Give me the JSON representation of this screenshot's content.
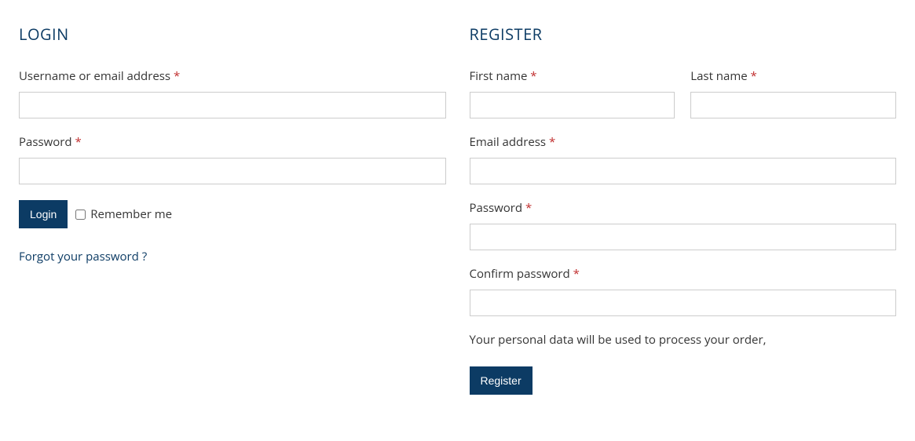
{
  "login": {
    "title": "LOGIN",
    "username_label": "Username or email address ",
    "password_label": "Password ",
    "button_label": "Login",
    "remember_label": "Remember me",
    "forgot_label": "Forgot your password ?"
  },
  "register": {
    "title": "REGISTER",
    "first_name_label": "First name ",
    "last_name_label": "Last name ",
    "email_label": "Email address ",
    "password_label": "Password ",
    "confirm_password_label": "Confirm password ",
    "privacy_text": "Your personal data will be used to process your order,",
    "button_label": "Register"
  },
  "required_mark": "*"
}
